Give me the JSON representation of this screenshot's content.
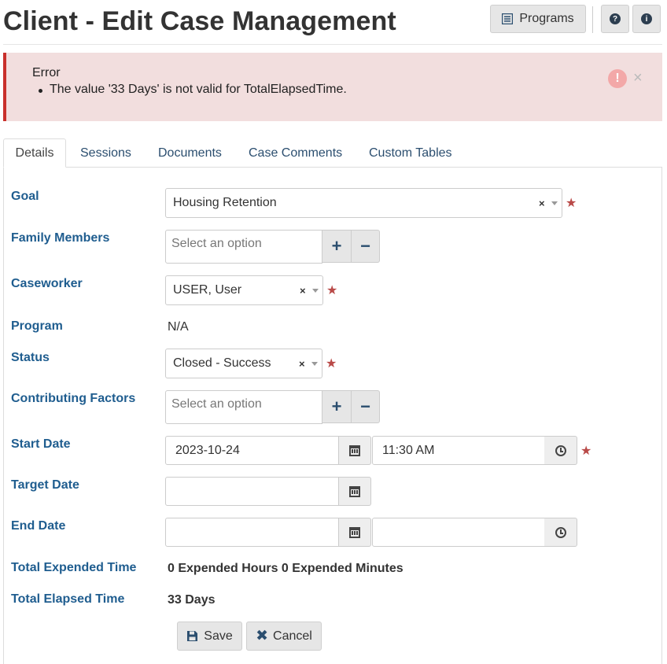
{
  "header": {
    "title": "Client - Edit Case Management",
    "programs_label": "Programs"
  },
  "alert": {
    "title": "Error",
    "messages": [
      "The value '33 Days' is not valid for TotalElapsedTime."
    ]
  },
  "tabs": [
    {
      "label": "Details",
      "active": true
    },
    {
      "label": "Sessions"
    },
    {
      "label": "Documents"
    },
    {
      "label": "Case Comments"
    },
    {
      "label": "Custom Tables"
    }
  ],
  "form": {
    "goal": {
      "label": "Goal",
      "value": "Housing Retention"
    },
    "family_members": {
      "label": "Family Members",
      "placeholder": "Select an option"
    },
    "caseworker": {
      "label": "Caseworker",
      "value": "USER, User"
    },
    "program": {
      "label": "Program",
      "value": "N/A"
    },
    "status": {
      "label": "Status",
      "value": "Closed - Success"
    },
    "contributing_factors": {
      "label": "Contributing Factors",
      "placeholder": "Select an option"
    },
    "start_date": {
      "label": "Start Date",
      "date": "2023-10-24",
      "time": "11:30 AM"
    },
    "target_date": {
      "label": "Target Date",
      "date": ""
    },
    "end_date": {
      "label": "End Date",
      "date": "",
      "time": ""
    },
    "total_expended_time": {
      "label": "Total Expended Time",
      "value": "0 Expended Hours 0 Expended Minutes"
    },
    "total_elapsed_time": {
      "label": "Total Elapsed Time",
      "value": "33 Days"
    }
  },
  "actions": {
    "save_label": "Save",
    "cancel_label": "Cancel"
  },
  "colors": {
    "label_blue": "#1f5d8f",
    "alert_bg": "#f2dede",
    "alert_border": "#c9302c",
    "required_star": "#b94a48"
  }
}
